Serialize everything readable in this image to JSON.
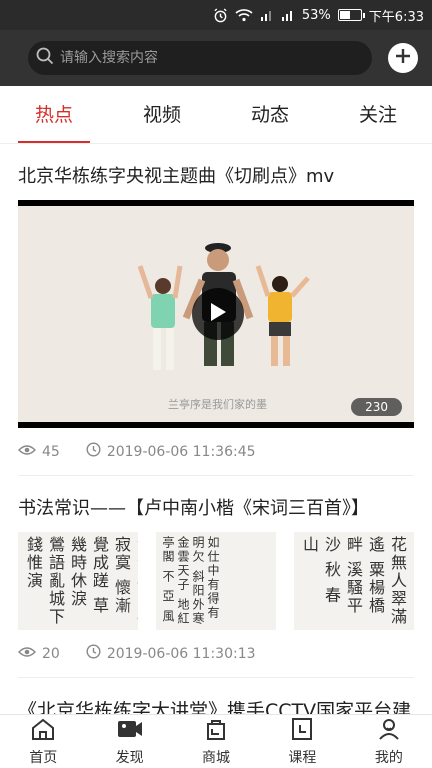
{
  "status_bar": {
    "battery_percent": "53%",
    "time": "下午6:33",
    "battery_level": 0.53
  },
  "search": {
    "placeholder": "请输入搜索内容",
    "icons": [
      "search-icon",
      "plus-icon"
    ]
  },
  "tabs": [
    {
      "label": "热点",
      "active": true
    },
    {
      "label": "视频",
      "active": false
    },
    {
      "label": "动态",
      "active": false
    },
    {
      "label": "关注",
      "active": false
    }
  ],
  "accent_color": "#d4302b",
  "feed": [
    {
      "title": "北京华栋练字央视主题曲《切刷点》mv",
      "duration": "230",
      "views": "45",
      "time": "2019-06-06 11:36:45",
      "video_caption": "兰亭序是我们家的墨"
    },
    {
      "title": "书法常识——【卢中南小楷《宋词三百首》】",
      "views": "20",
      "time": "2019-06-06 11:30:13",
      "thumbs": [
        {
          "text": "浅昔年多病寂寞 懷漸覺成蹉 草幾時休淚 鶯語亂城下 錢惟演"
        },
        {
          "text": "如仕中有得有明欠 斜阳外寒 金雲天子 地紅 亭閣 不 亞 風"
        },
        {
          "text": "花無人翠滿遙 粟楊橋畔 溪騷平沙 秋 春 山"
        }
      ]
    },
    {
      "title": "《北京华栋练字大讲堂》携手CCTV国家平台建"
    }
  ],
  "bottom_nav": [
    {
      "label": "首页",
      "icon": "home-icon",
      "active": false
    },
    {
      "label": "发现",
      "icon": "video-camera-icon",
      "active": false
    },
    {
      "label": "商城",
      "icon": "shop-bag-icon",
      "active": false
    },
    {
      "label": "课程",
      "icon": "course-book-icon",
      "active": false
    },
    {
      "label": "我的",
      "icon": "user-icon",
      "active": false
    }
  ]
}
